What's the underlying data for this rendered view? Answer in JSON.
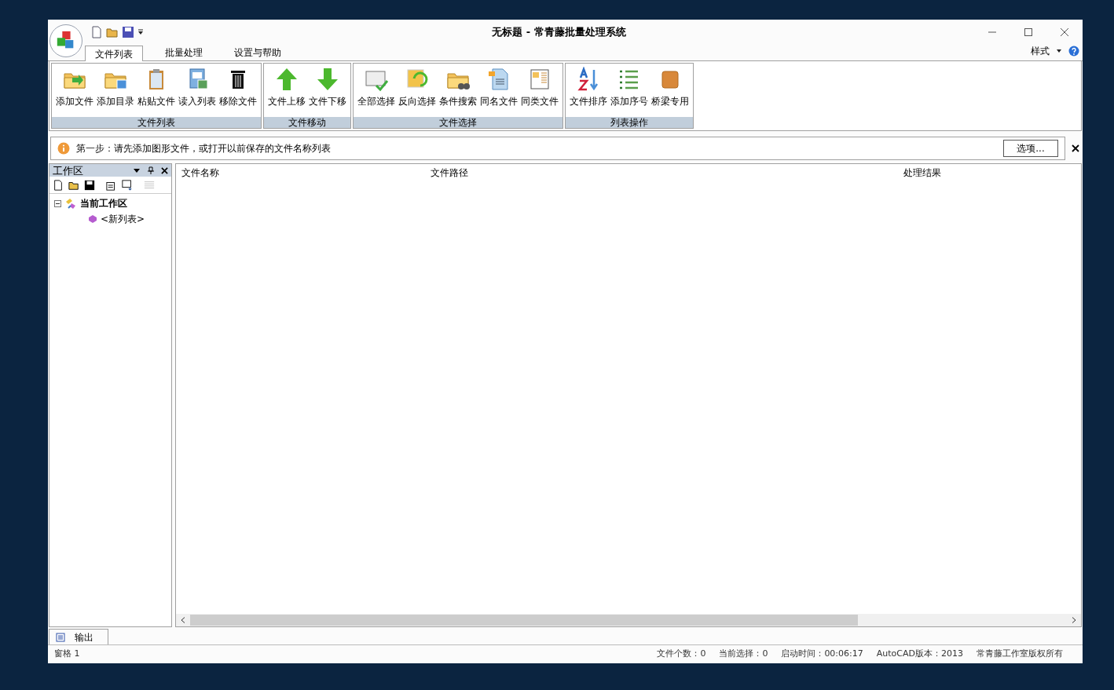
{
  "window": {
    "title": "无标题 - 常青藤批量处理系统"
  },
  "tabs": [
    {
      "label": "文件列表",
      "selected": true
    },
    {
      "label": "批量处理",
      "selected": false
    },
    {
      "label": "设置与帮助",
      "selected": false
    }
  ],
  "style_menu": "样式",
  "ribbon": [
    {
      "label": "文件列表",
      "buttons": [
        "添加文件",
        "添加目录",
        "粘贴文件",
        "读入列表",
        "移除文件"
      ]
    },
    {
      "label": "文件移动",
      "buttons": [
        "文件上移",
        "文件下移"
      ]
    },
    {
      "label": "文件选择",
      "buttons": [
        "全部选择",
        "反向选择",
        "条件搜索",
        "同名文件",
        "同类文件"
      ]
    },
    {
      "label": "列表操作",
      "buttons": [
        "文件排序",
        "添加序号",
        "桥梁专用"
      ]
    }
  ],
  "info_bar": {
    "message": "第一步：请先添加图形文件，或打开以前保存的文件名称列表",
    "button": "选项..."
  },
  "workspace": {
    "title": "工作区",
    "tree": [
      {
        "label": "当前工作区",
        "expanded": true,
        "children": [
          {
            "label": "<新列表>"
          }
        ]
      }
    ]
  },
  "table": {
    "columns": [
      "文件名称",
      "文件路径",
      "处理结果"
    ]
  },
  "bottom_tab": "输出",
  "status_bar": {
    "pane": "窗格 1",
    "items": [
      "文件个数：0",
      "当前选择：0",
      "启动时间：00:06:17",
      "AutoCAD版本：2013",
      "常青藤工作室版权所有"
    ]
  }
}
